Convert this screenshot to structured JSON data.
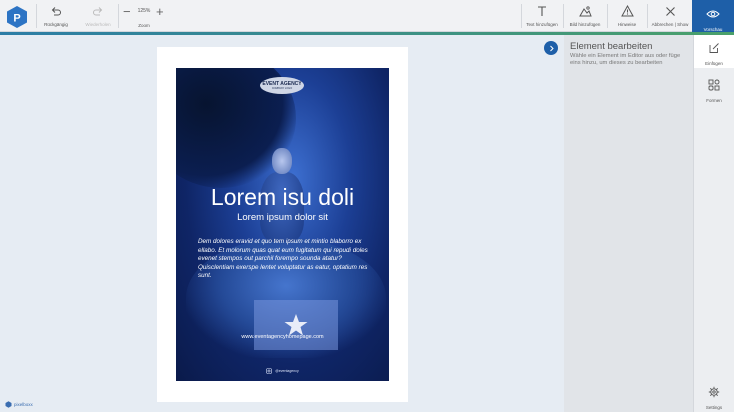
{
  "toolbar": {
    "undo_label": "Rückgängig",
    "redo_label": "Wiederholen",
    "zoom_value": "125%",
    "zoom_label": "Zoom",
    "add_text_label": "Text hinzufügen",
    "add_image_label": "Bild hinzufügen",
    "notes_label": "Hinweise",
    "cancel_label": "Abbrechen | Show",
    "preview_label": "Vorschau"
  },
  "panel": {
    "title": "Element bearbeiten",
    "description": "Wähle ein Element im Editor aus oder füge eins hinzu, um dieses zu bearbeiten"
  },
  "sidebar": {
    "items": [
      {
        "label": "Einfügen"
      },
      {
        "label": "Formen"
      }
    ],
    "settings_label": "Settings"
  },
  "flyer": {
    "agency_name": "EVENT AGENCY",
    "agency_tagline": "COMPANY LOGO",
    "headline": "Lorem isu doli",
    "subheadline": "Lorem ipsum dolor sit",
    "body": "Dem dolores eravid et quo tem ipsum et mintio blaborro ex ellabo. Et molorum quas quat eum fugitatum qui repudi doles evenet stempos out parchil forempo sounda atatur? Quisclentiam exerspe lentet voluptatur as eatur, optatium res sunt.",
    "url": "www.eventagencyhomepage.com",
    "social_handle": "@eventagency"
  },
  "brand": {
    "name": "pixelboxx"
  },
  "colors": {
    "accent": "#1e5fa8",
    "topbar": "#f1f2f4",
    "canvas_bg": "#e6ecf3"
  }
}
